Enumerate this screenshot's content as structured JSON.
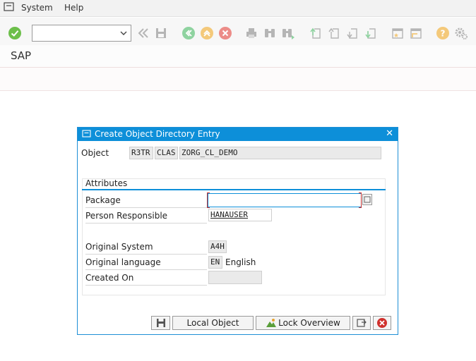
{
  "menu": {
    "items": [
      {
        "label": "System",
        "icon": "menu-icon"
      },
      {
        "label": "Help"
      }
    ]
  },
  "toolbar": {
    "command_field": {
      "value": "",
      "placeholder": ""
    },
    "icons": [
      "enter-icon",
      "back-nav-icon",
      "save-icon",
      "back-icon",
      "exit-icon",
      "cancel-icon",
      "print-icon",
      "find-icon",
      "find-next-icon",
      "first-page-icon",
      "previous-page-icon",
      "next-page-icon",
      "last-page-icon",
      "create-session-icon",
      "shortcut-icon",
      "help-icon",
      "settings-icon"
    ]
  },
  "app": {
    "title": "SAP"
  },
  "dialog": {
    "title": "Create Object Directory Entry",
    "object_label": "Object",
    "object_values": [
      "R3TR",
      "CLAS",
      "ZORG_CL_DEMO"
    ],
    "group_title": "Attributes",
    "fields": {
      "package": {
        "label": "Package",
        "value": ""
      },
      "person": {
        "label": "Person Responsible",
        "value": "HANAUSER"
      },
      "orig_system": {
        "label": "Original System",
        "value": "A4H"
      },
      "orig_language": {
        "label": "Original language",
        "value": "EN",
        "text": "English"
      },
      "created_on": {
        "label": "Created On",
        "value": ""
      }
    },
    "buttons": {
      "local_object": "Local Object",
      "lock_overview": "Lock Overview"
    }
  },
  "colors": {
    "accent": "#0d8fd9",
    "cancel": "#d0312d",
    "ok": "#6cbf4a"
  }
}
